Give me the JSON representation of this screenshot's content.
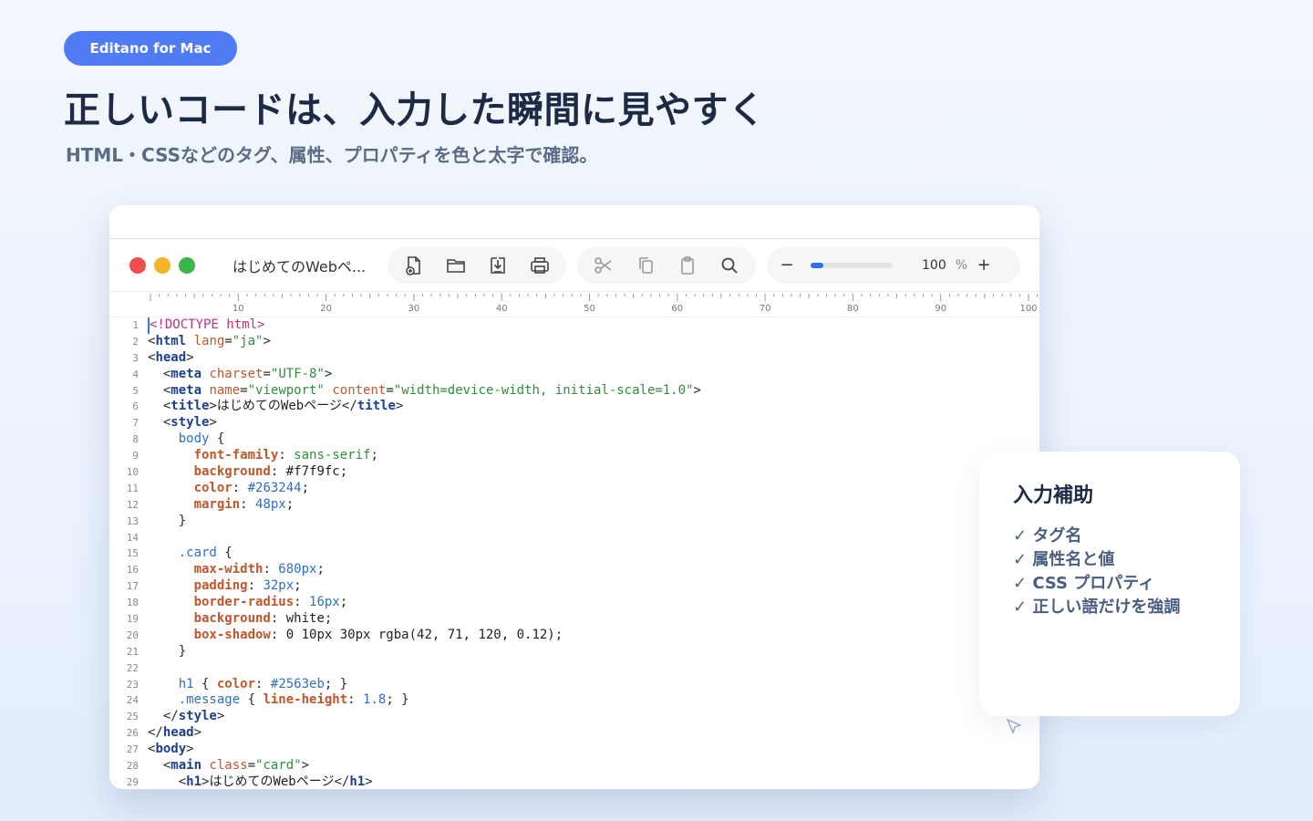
{
  "badge": "Editano for Mac",
  "headline": "正しいコードは、入力した瞬間に見やすく",
  "subline": "HTML・CSSなどのタグ、属性、プロパティを色と太字で確認。",
  "window": {
    "doc_title": "はじめてのWebペ...",
    "toolbar_icons": [
      "new-document-icon",
      "folder-icon",
      "save-icon",
      "print-icon",
      "scissors-icon",
      "copy-icon",
      "paste-icon",
      "search-icon"
    ],
    "zoom": {
      "minus": "−",
      "value": "100",
      "unit": "%",
      "plus": "+",
      "slider_level": 0.15
    },
    "ruler_labels": [
      "10",
      "20",
      "30",
      "40",
      "50",
      "60",
      "70",
      "80",
      "90",
      "100"
    ]
  },
  "code_lines": [
    [
      [
        "doctype",
        "<!DOCTYPE html>"
      ]
    ],
    [
      [
        "punct",
        "<"
      ],
      [
        "tag",
        "html"
      ],
      [
        "text",
        " "
      ],
      [
        "attr",
        "lang"
      ],
      [
        "punct",
        "="
      ],
      [
        "str",
        "\"ja\""
      ],
      [
        "punct",
        ">"
      ]
    ],
    [
      [
        "punct",
        "<"
      ],
      [
        "tag",
        "head"
      ],
      [
        "punct",
        ">"
      ]
    ],
    [
      [
        "text",
        "  "
      ],
      [
        "punct",
        "<"
      ],
      [
        "tag",
        "meta"
      ],
      [
        "text",
        " "
      ],
      [
        "attr",
        "charset"
      ],
      [
        "punct",
        "="
      ],
      [
        "str",
        "\"UTF-8\""
      ],
      [
        "punct",
        ">"
      ]
    ],
    [
      [
        "text",
        "  "
      ],
      [
        "punct",
        "<"
      ],
      [
        "tag",
        "meta"
      ],
      [
        "text",
        " "
      ],
      [
        "attr",
        "name"
      ],
      [
        "punct",
        "="
      ],
      [
        "str",
        "\"viewport\""
      ],
      [
        "text",
        " "
      ],
      [
        "attr",
        "content"
      ],
      [
        "punct",
        "="
      ],
      [
        "str",
        "\"width=device-width, initial-scale=1.0\""
      ],
      [
        "punct",
        ">"
      ]
    ],
    [
      [
        "text",
        "  "
      ],
      [
        "punct",
        "<"
      ],
      [
        "tag",
        "title"
      ],
      [
        "punct",
        ">"
      ],
      [
        "text",
        "はじめてのWebページ"
      ],
      [
        "punct",
        "</"
      ],
      [
        "tag",
        "title"
      ],
      [
        "punct",
        ">"
      ]
    ],
    [
      [
        "text",
        "  "
      ],
      [
        "punct",
        "<"
      ],
      [
        "tag",
        "style"
      ],
      [
        "punct",
        ">"
      ]
    ],
    [
      [
        "text",
        "    "
      ],
      [
        "sel",
        "body"
      ],
      [
        "punct",
        " {"
      ]
    ],
    [
      [
        "text",
        "      "
      ],
      [
        "prop",
        "font-family"
      ],
      [
        "punct",
        ": "
      ],
      [
        "str",
        "sans-serif"
      ],
      [
        "punct",
        ";"
      ]
    ],
    [
      [
        "text",
        "      "
      ],
      [
        "prop",
        "background"
      ],
      [
        "punct",
        ": "
      ],
      [
        "text",
        "#f7f9fc"
      ],
      [
        "punct",
        ";"
      ]
    ],
    [
      [
        "text",
        "      "
      ],
      [
        "prop",
        "color"
      ],
      [
        "punct",
        ": "
      ],
      [
        "val",
        "#263244"
      ],
      [
        "punct",
        ";"
      ]
    ],
    [
      [
        "text",
        "      "
      ],
      [
        "prop",
        "margin"
      ],
      [
        "punct",
        ": "
      ],
      [
        "val",
        "48px"
      ],
      [
        "punct",
        ";"
      ]
    ],
    [
      [
        "text",
        "    "
      ],
      [
        "punct",
        "}"
      ]
    ],
    [],
    [
      [
        "text",
        "    "
      ],
      [
        "sel",
        ".card"
      ],
      [
        "punct",
        " {"
      ]
    ],
    [
      [
        "text",
        "      "
      ],
      [
        "prop",
        "max-width"
      ],
      [
        "punct",
        ": "
      ],
      [
        "val",
        "680px"
      ],
      [
        "punct",
        ";"
      ]
    ],
    [
      [
        "text",
        "      "
      ],
      [
        "prop",
        "padding"
      ],
      [
        "punct",
        ": "
      ],
      [
        "val",
        "32px"
      ],
      [
        "punct",
        ";"
      ]
    ],
    [
      [
        "text",
        "      "
      ],
      [
        "prop",
        "border-radius"
      ],
      [
        "punct",
        ": "
      ],
      [
        "val",
        "16px"
      ],
      [
        "punct",
        ";"
      ]
    ],
    [
      [
        "text",
        "      "
      ],
      [
        "prop",
        "background"
      ],
      [
        "punct",
        ": "
      ],
      [
        "text",
        "white"
      ],
      [
        "punct",
        ";"
      ]
    ],
    [
      [
        "text",
        "      "
      ],
      [
        "prop",
        "box-shadow"
      ],
      [
        "punct",
        ": "
      ],
      [
        "text",
        "0 10px 30px rgba(42, 71, 120, 0.12)"
      ],
      [
        "punct",
        ";"
      ]
    ],
    [
      [
        "text",
        "    "
      ],
      [
        "punct",
        "}"
      ]
    ],
    [],
    [
      [
        "text",
        "    "
      ],
      [
        "sel",
        "h1"
      ],
      [
        "punct",
        " { "
      ],
      [
        "prop",
        "color"
      ],
      [
        "punct",
        ": "
      ],
      [
        "val",
        "#2563eb"
      ],
      [
        "punct",
        "; }"
      ]
    ],
    [
      [
        "text",
        "    "
      ],
      [
        "sel",
        ".message"
      ],
      [
        "punct",
        " { "
      ],
      [
        "prop",
        "line-height"
      ],
      [
        "punct",
        ": "
      ],
      [
        "val",
        "1.8"
      ],
      [
        "punct",
        "; }"
      ]
    ],
    [
      [
        "text",
        "  "
      ],
      [
        "punct",
        "</"
      ],
      [
        "tag",
        "style"
      ],
      [
        "punct",
        ">"
      ]
    ],
    [
      [
        "punct",
        "</"
      ],
      [
        "tag",
        "head"
      ],
      [
        "punct",
        ">"
      ]
    ],
    [
      [
        "punct",
        "<"
      ],
      [
        "tag",
        "body"
      ],
      [
        "punct",
        ">"
      ]
    ],
    [
      [
        "text",
        "  "
      ],
      [
        "punct",
        "<"
      ],
      [
        "tag",
        "main"
      ],
      [
        "text",
        " "
      ],
      [
        "attr",
        "class"
      ],
      [
        "punct",
        "="
      ],
      [
        "str",
        "\"card\""
      ],
      [
        "punct",
        ">"
      ]
    ],
    [
      [
        "text",
        "    "
      ],
      [
        "punct",
        "<"
      ],
      [
        "tag",
        "h1"
      ],
      [
        "punct",
        ">"
      ],
      [
        "text",
        "はじめてのWebページ"
      ],
      [
        "punct",
        "</"
      ],
      [
        "tag",
        "h1"
      ],
      [
        "punct",
        ">"
      ]
    ]
  ],
  "card": {
    "title": "入力補助",
    "items": [
      "✓ タグ名",
      "✓ 属性名と値",
      "✓ CSS プロパティ",
      "✓ 正しい語だけを強調"
    ]
  }
}
